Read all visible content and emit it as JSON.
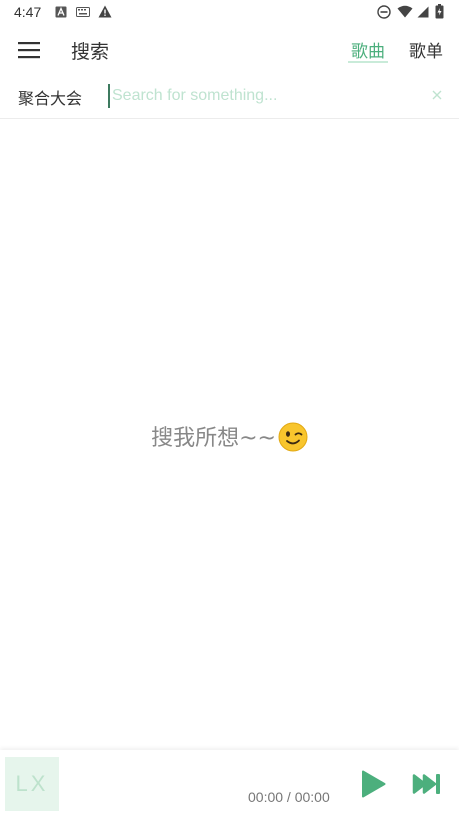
{
  "status_bar": {
    "time": "4:47",
    "icons": [
      "font-a-icon",
      "keyboard-icon",
      "warning-icon",
      "do-not-disturb-icon",
      "wifi-icon",
      "signal-icon",
      "battery-icon"
    ]
  },
  "header": {
    "title": "搜索",
    "tabs": [
      {
        "label": "歌曲",
        "active": true
      },
      {
        "label": "歌单",
        "active": false
      }
    ]
  },
  "search": {
    "source_label": "聚合大会",
    "placeholder": "Search for something...",
    "value": ""
  },
  "empty_state": {
    "message": "搜我所想~~",
    "emoji": "winking-face-icon"
  },
  "player": {
    "album_art_text": "LX",
    "time": "00:00 / 00:00"
  },
  "colors": {
    "accent": "#4caf7d",
    "accent_light": "#c9ebd9",
    "album_bg": "#e6f5ec"
  }
}
